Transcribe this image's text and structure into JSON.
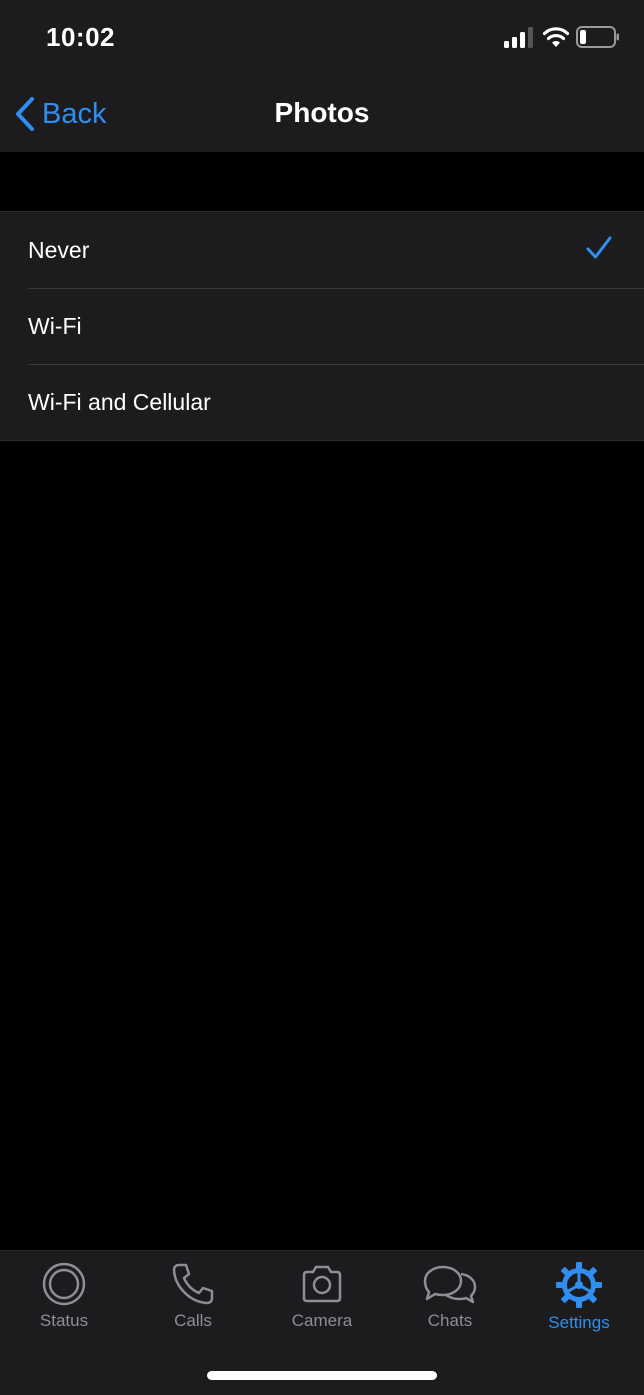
{
  "status_bar": {
    "time": "10:02"
  },
  "nav": {
    "back_label": "Back",
    "title": "Photos"
  },
  "options": [
    {
      "label": "Never",
      "selected": true
    },
    {
      "label": "Wi-Fi",
      "selected": false
    },
    {
      "label": "Wi-Fi and Cellular",
      "selected": false
    }
  ],
  "tabs": [
    {
      "label": "Status",
      "icon": "status-icon"
    },
    {
      "label": "Calls",
      "icon": "phone-icon"
    },
    {
      "label": "Camera",
      "icon": "camera-icon"
    },
    {
      "label": "Chats",
      "icon": "chats-icon"
    },
    {
      "label": "Settings",
      "icon": "settings-icon",
      "active": true
    }
  ],
  "colors": {
    "accent": "#2f8ff0",
    "inactive": "#8e8e93",
    "bar_bg": "#1c1c1e",
    "page_bg": "#000000"
  }
}
